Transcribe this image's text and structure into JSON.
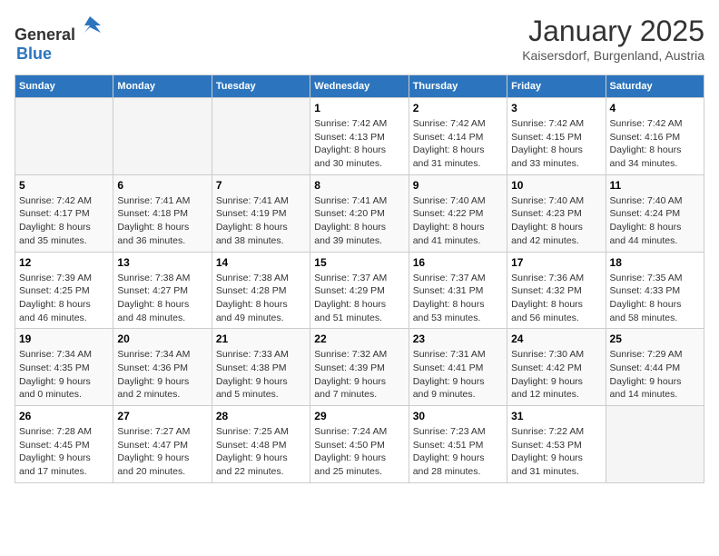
{
  "header": {
    "logo_general": "General",
    "logo_blue": "Blue",
    "month_title": "January 2025",
    "subtitle": "Kaisersdorf, Burgenland, Austria"
  },
  "weekdays": [
    "Sunday",
    "Monday",
    "Tuesday",
    "Wednesday",
    "Thursday",
    "Friday",
    "Saturday"
  ],
  "weeks": [
    [
      {
        "day": "",
        "info": ""
      },
      {
        "day": "",
        "info": ""
      },
      {
        "day": "",
        "info": ""
      },
      {
        "day": "1",
        "info": "Sunrise: 7:42 AM\nSunset: 4:13 PM\nDaylight: 8 hours\nand 30 minutes."
      },
      {
        "day": "2",
        "info": "Sunrise: 7:42 AM\nSunset: 4:14 PM\nDaylight: 8 hours\nand 31 minutes."
      },
      {
        "day": "3",
        "info": "Sunrise: 7:42 AM\nSunset: 4:15 PM\nDaylight: 8 hours\nand 33 minutes."
      },
      {
        "day": "4",
        "info": "Sunrise: 7:42 AM\nSunset: 4:16 PM\nDaylight: 8 hours\nand 34 minutes."
      }
    ],
    [
      {
        "day": "5",
        "info": "Sunrise: 7:42 AM\nSunset: 4:17 PM\nDaylight: 8 hours\nand 35 minutes."
      },
      {
        "day": "6",
        "info": "Sunrise: 7:41 AM\nSunset: 4:18 PM\nDaylight: 8 hours\nand 36 minutes."
      },
      {
        "day": "7",
        "info": "Sunrise: 7:41 AM\nSunset: 4:19 PM\nDaylight: 8 hours\nand 38 minutes."
      },
      {
        "day": "8",
        "info": "Sunrise: 7:41 AM\nSunset: 4:20 PM\nDaylight: 8 hours\nand 39 minutes."
      },
      {
        "day": "9",
        "info": "Sunrise: 7:40 AM\nSunset: 4:22 PM\nDaylight: 8 hours\nand 41 minutes."
      },
      {
        "day": "10",
        "info": "Sunrise: 7:40 AM\nSunset: 4:23 PM\nDaylight: 8 hours\nand 42 minutes."
      },
      {
        "day": "11",
        "info": "Sunrise: 7:40 AM\nSunset: 4:24 PM\nDaylight: 8 hours\nand 44 minutes."
      }
    ],
    [
      {
        "day": "12",
        "info": "Sunrise: 7:39 AM\nSunset: 4:25 PM\nDaylight: 8 hours\nand 46 minutes."
      },
      {
        "day": "13",
        "info": "Sunrise: 7:38 AM\nSunset: 4:27 PM\nDaylight: 8 hours\nand 48 minutes."
      },
      {
        "day": "14",
        "info": "Sunrise: 7:38 AM\nSunset: 4:28 PM\nDaylight: 8 hours\nand 49 minutes."
      },
      {
        "day": "15",
        "info": "Sunrise: 7:37 AM\nSunset: 4:29 PM\nDaylight: 8 hours\nand 51 minutes."
      },
      {
        "day": "16",
        "info": "Sunrise: 7:37 AM\nSunset: 4:31 PM\nDaylight: 8 hours\nand 53 minutes."
      },
      {
        "day": "17",
        "info": "Sunrise: 7:36 AM\nSunset: 4:32 PM\nDaylight: 8 hours\nand 56 minutes."
      },
      {
        "day": "18",
        "info": "Sunrise: 7:35 AM\nSunset: 4:33 PM\nDaylight: 8 hours\nand 58 minutes."
      }
    ],
    [
      {
        "day": "19",
        "info": "Sunrise: 7:34 AM\nSunset: 4:35 PM\nDaylight: 9 hours\nand 0 minutes."
      },
      {
        "day": "20",
        "info": "Sunrise: 7:34 AM\nSunset: 4:36 PM\nDaylight: 9 hours\nand 2 minutes."
      },
      {
        "day": "21",
        "info": "Sunrise: 7:33 AM\nSunset: 4:38 PM\nDaylight: 9 hours\nand 5 minutes."
      },
      {
        "day": "22",
        "info": "Sunrise: 7:32 AM\nSunset: 4:39 PM\nDaylight: 9 hours\nand 7 minutes."
      },
      {
        "day": "23",
        "info": "Sunrise: 7:31 AM\nSunset: 4:41 PM\nDaylight: 9 hours\nand 9 minutes."
      },
      {
        "day": "24",
        "info": "Sunrise: 7:30 AM\nSunset: 4:42 PM\nDaylight: 9 hours\nand 12 minutes."
      },
      {
        "day": "25",
        "info": "Sunrise: 7:29 AM\nSunset: 4:44 PM\nDaylight: 9 hours\nand 14 minutes."
      }
    ],
    [
      {
        "day": "26",
        "info": "Sunrise: 7:28 AM\nSunset: 4:45 PM\nDaylight: 9 hours\nand 17 minutes."
      },
      {
        "day": "27",
        "info": "Sunrise: 7:27 AM\nSunset: 4:47 PM\nDaylight: 9 hours\nand 20 minutes."
      },
      {
        "day": "28",
        "info": "Sunrise: 7:25 AM\nSunset: 4:48 PM\nDaylight: 9 hours\nand 22 minutes."
      },
      {
        "day": "29",
        "info": "Sunrise: 7:24 AM\nSunset: 4:50 PM\nDaylight: 9 hours\nand 25 minutes."
      },
      {
        "day": "30",
        "info": "Sunrise: 7:23 AM\nSunset: 4:51 PM\nDaylight: 9 hours\nand 28 minutes."
      },
      {
        "day": "31",
        "info": "Sunrise: 7:22 AM\nSunset: 4:53 PM\nDaylight: 9 hours\nand 31 minutes."
      },
      {
        "day": "",
        "info": ""
      }
    ]
  ]
}
